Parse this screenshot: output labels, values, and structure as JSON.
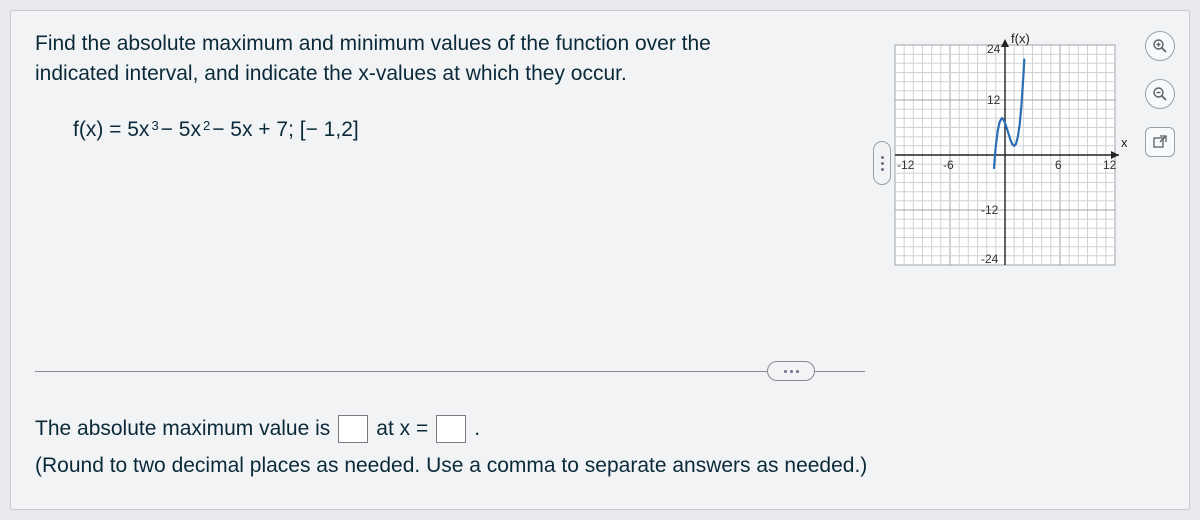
{
  "prompt": {
    "line1": "Find the absolute maximum and minimum values of the function over the",
    "line2": "indicated interval, and indicate the x-values at which they occur."
  },
  "formula": {
    "lhs": "f(x) = 5x",
    "exp1": "3",
    "mid1": " − 5x",
    "exp2": "2",
    "tail": " − 5x + 7; [− 1,2]"
  },
  "answer": {
    "lead": "The absolute maximum value is",
    "atx": "at x =",
    "hint": "(Round to two decimal places as needed. Use a comma to separate answers as needed.)"
  },
  "chart_data": {
    "type": "line",
    "title": "",
    "xlabel": "x",
    "ylabel": "f(x)",
    "xlim": [
      -12,
      12
    ],
    "ylim": [
      -24,
      24
    ],
    "x_ticks": [
      -12,
      -6,
      6,
      12
    ],
    "y_ticks": [
      -24,
      -12,
      12,
      24
    ],
    "series": [
      {
        "name": "f(x)=5x^3-5x^2-5x+7",
        "x": [
          -1.2,
          -1.0,
          -0.8,
          -0.6,
          -0.4,
          -0.333,
          -0.2,
          0.0,
          0.2,
          0.4,
          0.6,
          0.8,
          1.0,
          1.2,
          1.4,
          1.6,
          1.8,
          2.0,
          2.1
        ],
        "values": [
          -2.84,
          2.0,
          5.24,
          7.12,
          7.88,
          8.04,
          7.76,
          7.0,
          5.84,
          4.52,
          3.28,
          2.36,
          2.0,
          2.44,
          3.92,
          6.68,
          11.0,
          17.0,
          20.8
        ]
      }
    ]
  },
  "tools": {
    "zoom_in": "zoom-in",
    "zoom_out": "zoom-out",
    "popout": "popout"
  }
}
